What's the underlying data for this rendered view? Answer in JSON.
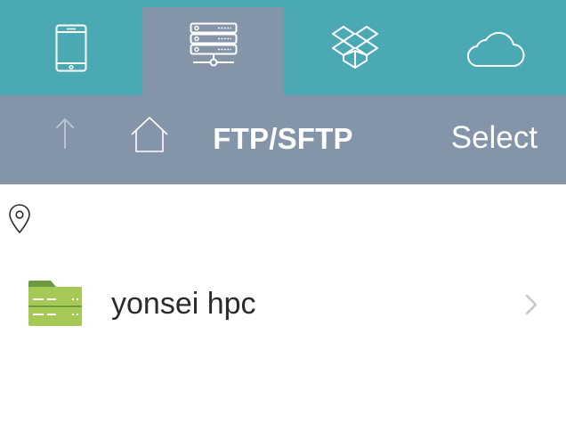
{
  "tabs": [
    {
      "icon": "phone-icon",
      "active": false
    },
    {
      "icon": "server-icon",
      "active": true
    },
    {
      "icon": "dropbox-icon",
      "active": false
    },
    {
      "icon": "cloud-icon",
      "active": false
    }
  ],
  "toolbar": {
    "up_icon": "up-arrow-icon",
    "home_icon": "home-icon",
    "title": "FTP/SFTP",
    "select_label": "Select"
  },
  "location_icon": "location-pin-icon",
  "list": {
    "items": [
      {
        "label": "yonsei hpc",
        "icon": "server-folder-icon"
      }
    ]
  },
  "colors": {
    "tabbar": "#4ba9b3",
    "active_tab": "#8494a9",
    "toolbar": "#8494a9",
    "folder": "#a5c955",
    "folder_tab": "#6e9a3f"
  }
}
